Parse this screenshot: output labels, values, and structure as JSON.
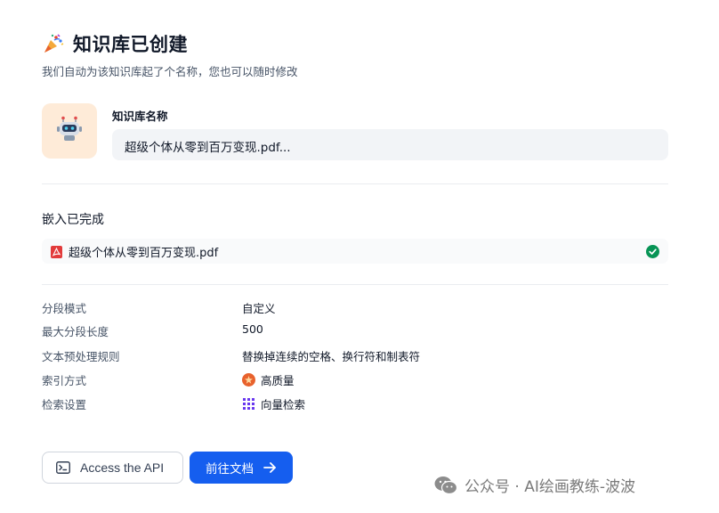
{
  "header": {
    "icon": "party-popper-icon",
    "title": "知识库已创建",
    "subtitle": "我们自动为该知识库起了个名称，您也可以随时修改"
  },
  "name_section": {
    "avatar_icon": "robot-icon",
    "avatar_bg": "#FEEBD8",
    "label": "知识库名称",
    "value": "超级个体从零到百万变现.pdf..."
  },
  "embedding": {
    "title": "嵌入已完成",
    "file": {
      "icon": "pdf-icon",
      "name": "超级个体从零到百万变现.pdf",
      "status_icon": "check-circle-icon",
      "status_color": "#079455"
    }
  },
  "settings": [
    {
      "label": "分段模式",
      "value": "自定义"
    },
    {
      "label": "最大分段长度",
      "value": "500"
    },
    {
      "label": "文本预处理规则",
      "value": "替换掉连续的空格、换行符和制表符"
    },
    {
      "label": "索引方式",
      "value": "高质量",
      "icon": "high-quality-icon"
    },
    {
      "label": "检索设置",
      "value": "向量检索",
      "icon": "vector-search-icon"
    }
  ],
  "actions": {
    "api_label": "Access the API",
    "api_icon": "terminal-icon",
    "docs_label": "前往文档",
    "docs_icon": "arrow-right-icon",
    "primary_color": "#155EEF"
  },
  "watermark": {
    "icon": "wechat-icon",
    "text": "公众号 · AI绘画教练-波波"
  }
}
